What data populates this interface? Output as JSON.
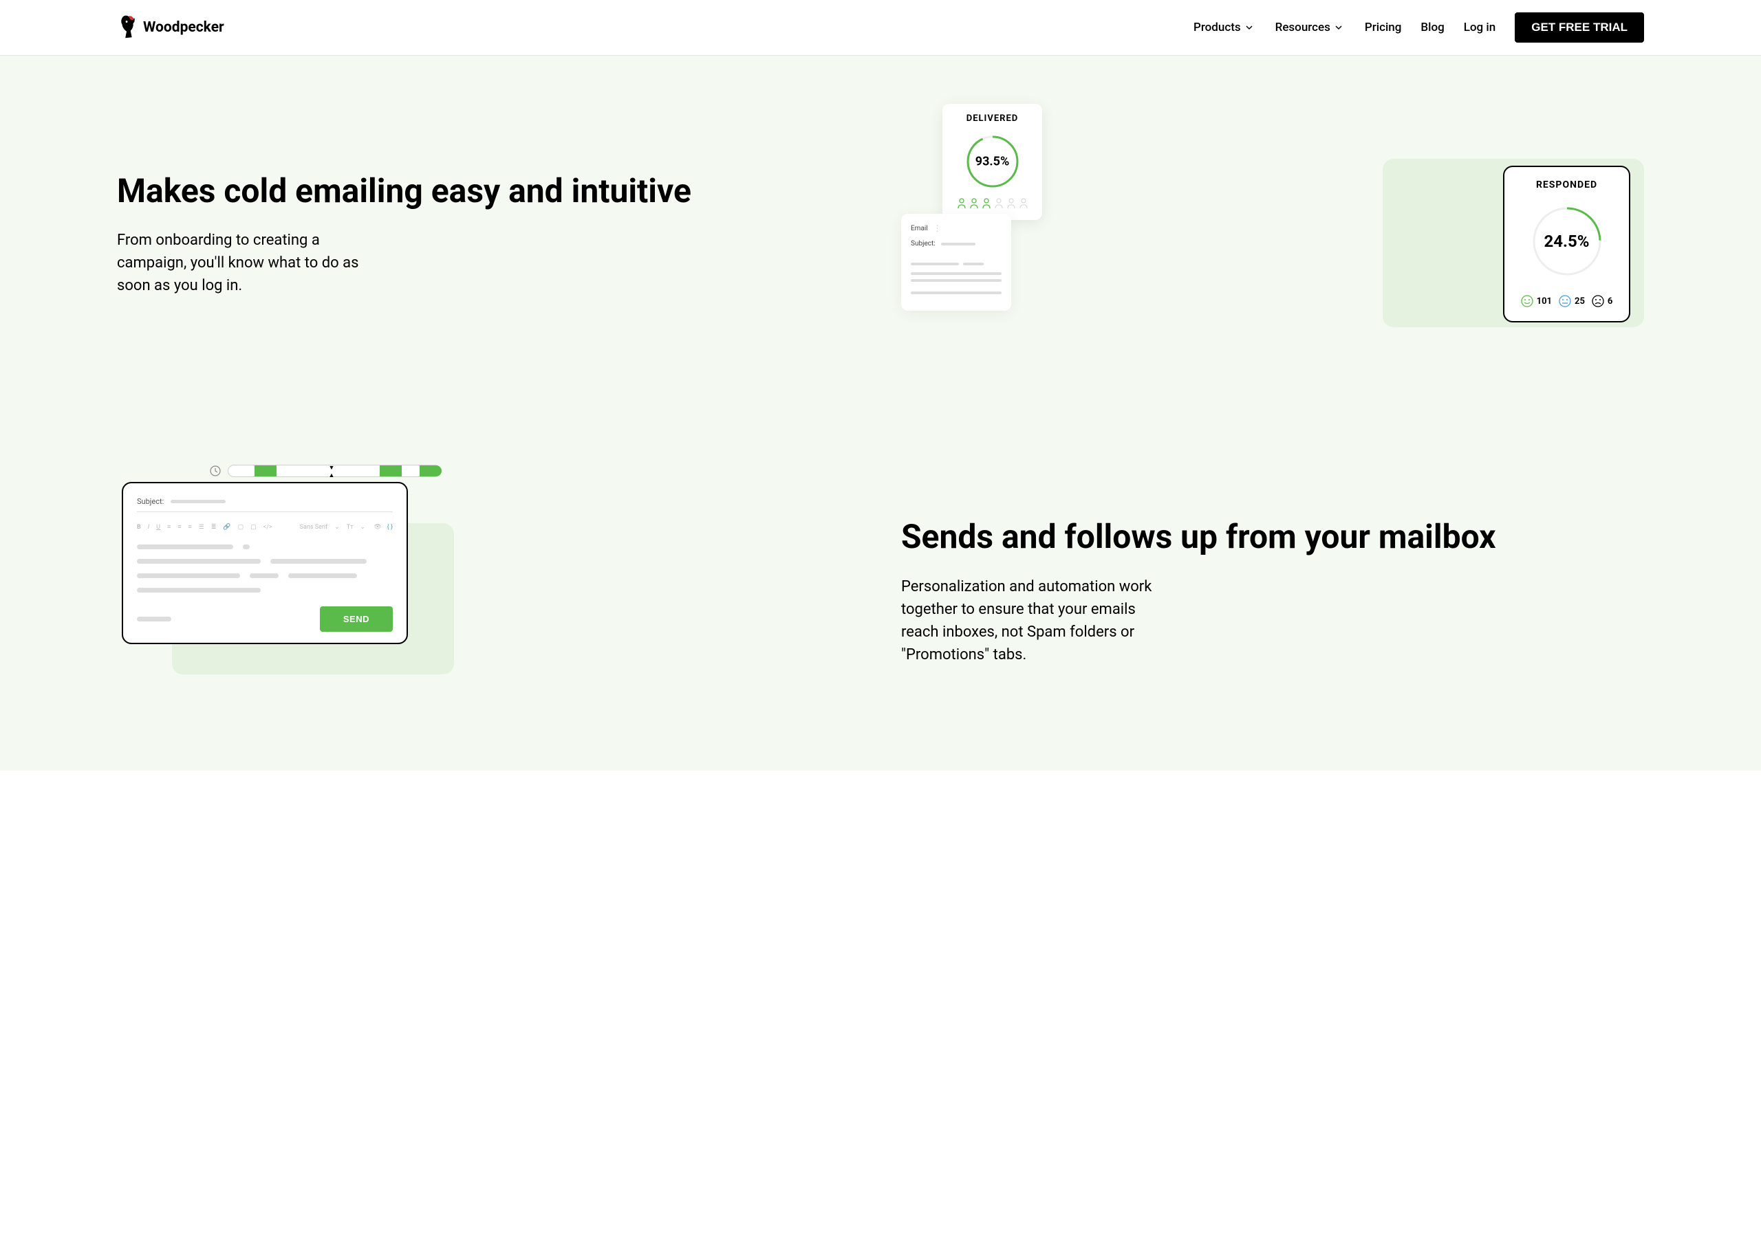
{
  "header": {
    "brand": "Woodpecker",
    "nav": {
      "products": "Products",
      "resources": "Resources",
      "pricing": "Pricing",
      "blog": "Blog",
      "login": "Log in"
    },
    "cta": "GET FREE TRIAL"
  },
  "section1": {
    "title": "Makes cold emailing easy and intuitive",
    "desc": "From onboarding to creating a campaign, you'll know what to do as soon as you log in."
  },
  "visual1": {
    "delivered_label": "DELIVERED",
    "delivered_pct": "93.5%",
    "responded_label": "RESPONDED",
    "responded_pct": "24.5%",
    "face_happy": "101",
    "face_neutral": "25",
    "face_sad": "6",
    "email_label": "Email",
    "subject_label": "Subject:"
  },
  "section2": {
    "title": "Sends and follows up from your mailbox",
    "desc": "Personalization and automation work together to ensure that your emails reach inboxes, not Spam folders or \"Promotions\" tabs."
  },
  "visual2": {
    "subject_label": "Subject:",
    "toolbar_font": "Sans Serif",
    "send_label": "SEND"
  }
}
